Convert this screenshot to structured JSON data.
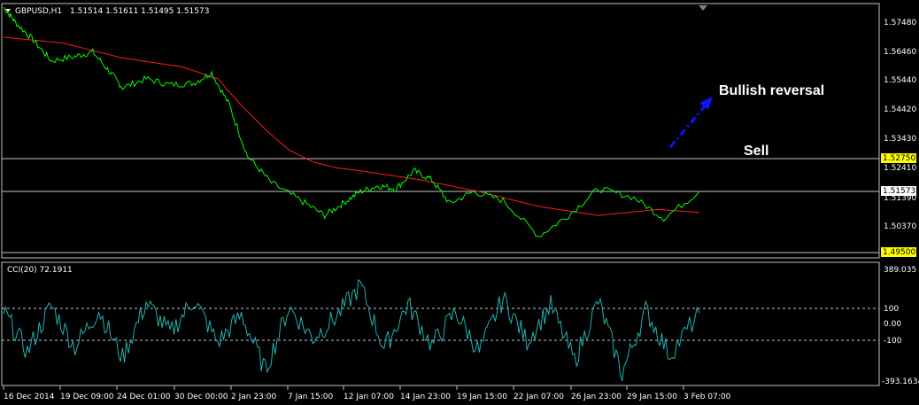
{
  "header": {
    "symbol_timeframe": "GBPUSD,H1",
    "ohlc": "1.51514 1.51611 1.51495 1.51573"
  },
  "colors": {
    "background": "#000000",
    "price": "#00ff00",
    "moving_average": "#ff1a1a",
    "indicator": "#20b2b2",
    "grid": "#c0c0c0",
    "arrow": "#1010ff",
    "price_label_bg": "#ffff00"
  },
  "annotations": {
    "bullish_reversal": "Bullish reversal",
    "sell": "Sell"
  },
  "cci_label": "CCI(20) 72.1911",
  "chart_data": [
    {
      "type": "line",
      "title": "GBPUSD,H1",
      "ylim": [
        1.494,
        1.579
      ],
      "y_ticks": [
        "1.57480",
        "1.56460",
        "1.55440",
        "1.54420",
        "1.53430",
        "1.52410",
        "1.51390",
        "1.50370"
      ],
      "horizontal_lines": [
        {
          "value": 1.5275,
          "label": "1.52750"
        },
        {
          "value": 1.51573,
          "label": "1.51573"
        },
        {
          "value": 1.495,
          "label": "1.49500"
        }
      ],
      "x_ticks": [
        "16 Dec 2014",
        "19 Dec 09:00",
        "24 Dec 01:00",
        "30 Dec 00:00",
        "2 Jan 23:00",
        "7 Jan 15:00",
        "12 Jan 07:00",
        "14 Jan 23:00",
        "19 Jan 15:00",
        "22 Jan 07:00",
        "26 Jan 23:00",
        "29 Jan 15:00",
        "3 Feb 07:00"
      ],
      "series": [
        {
          "role": "price",
          "x": [
            0,
            2,
            5,
            8,
            12,
            15,
            18,
            20,
            24,
            28,
            32,
            35,
            38,
            41,
            45,
            50,
            54,
            57,
            60,
            63,
            66,
            69,
            72,
            75,
            79,
            84,
            90,
            95,
            100,
            106,
            111,
            117
          ],
          "values": [
            1.578,
            1.573,
            1.567,
            1.56,
            1.5615,
            1.563,
            1.556,
            1.551,
            1.554,
            1.552,
            1.5525,
            1.556,
            1.545,
            1.528,
            1.519,
            1.513,
            1.508,
            1.512,
            1.516,
            1.518,
            1.517,
            1.523,
            1.52,
            1.512,
            1.516,
            1.513,
            1.501,
            1.508,
            1.517,
            1.514,
            1.507,
            1.516
          ]
        },
        {
          "role": "moving_average",
          "x": [
            0,
            10,
            20,
            30,
            36,
            40,
            44,
            48,
            52,
            56,
            60,
            70,
            80,
            86,
            90,
            100,
            110,
            117
          ],
          "values": [
            1.568,
            1.566,
            1.561,
            1.558,
            1.554,
            1.545,
            1.537,
            1.53,
            1.526,
            1.524,
            1.523,
            1.52,
            1.516,
            1.513,
            1.511,
            1.508,
            1.51,
            1.509
          ]
        }
      ]
    },
    {
      "type": "line",
      "title": "CCI(20) 72.1911",
      "ylim": [
        -393.1634,
        389.035
      ],
      "y_ticks": [
        "389.035",
        "100",
        "0.00",
        "-100",
        "-393.1634"
      ],
      "levels": [
        100,
        -100
      ],
      "series": [
        {
          "role": "indicator",
          "x": [
            0,
            4,
            8,
            12,
            16,
            20,
            24,
            28,
            32,
            36,
            40,
            44,
            48,
            52,
            56,
            60,
            64,
            68,
            72,
            76,
            80,
            84,
            88,
            92,
            96,
            100,
            104,
            108,
            112,
            117
          ],
          "values": [
            80,
            -180,
            120,
            -150,
            90,
            -220,
            140,
            -60,
            160,
            -120,
            60,
            -300,
            110,
            -90,
            50,
            250,
            -160,
            130,
            -140,
            80,
            -180,
            170,
            -110,
            120,
            -240,
            150,
            -320,
            90,
            -200,
            72
          ]
        }
      ]
    }
  ]
}
